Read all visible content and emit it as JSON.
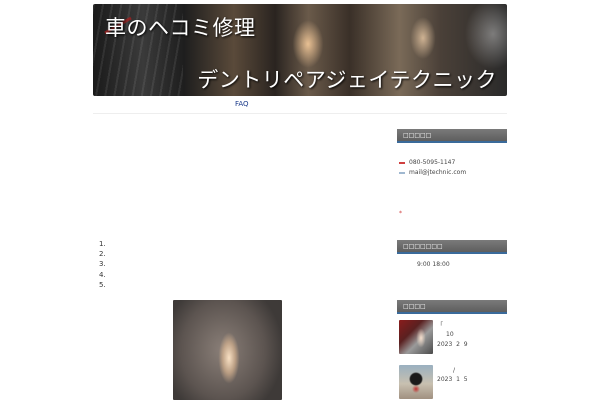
{
  "banner": {
    "title": "車のヘコミ修理",
    "subtitle": "デントリペアジェイテクニック"
  },
  "nav": {
    "items": [
      {
        "label": "FAQ"
      }
    ]
  },
  "main": {
    "ordered_list": [
      "1.",
      "2.",
      "3.",
      "4.",
      "5."
    ]
  },
  "sidebar": {
    "widgets": [
      {
        "title": "□□□□□"
      },
      {
        "title": "□□□□□□□"
      },
      {
        "title": "□□□□"
      }
    ],
    "contact": {
      "phone": "080-5095-1147",
      "email": "mail@jtechnic.com",
      "note": "*"
    },
    "hours": {
      "text": "9:00  18:00"
    },
    "posts": [
      {
        "line1": "「",
        "line2": "10",
        "date": "2023  2  9"
      },
      {
        "line1": "/",
        "date": "2023  1  5"
      }
    ]
  },
  "colors": {
    "nav_link": "#1a3a8a",
    "widget_title_bg": "#6a6a6a",
    "widget_title_border": "#3a6a9a",
    "phone_mark": "#d04040",
    "email_mark": "#a0b8d0"
  }
}
